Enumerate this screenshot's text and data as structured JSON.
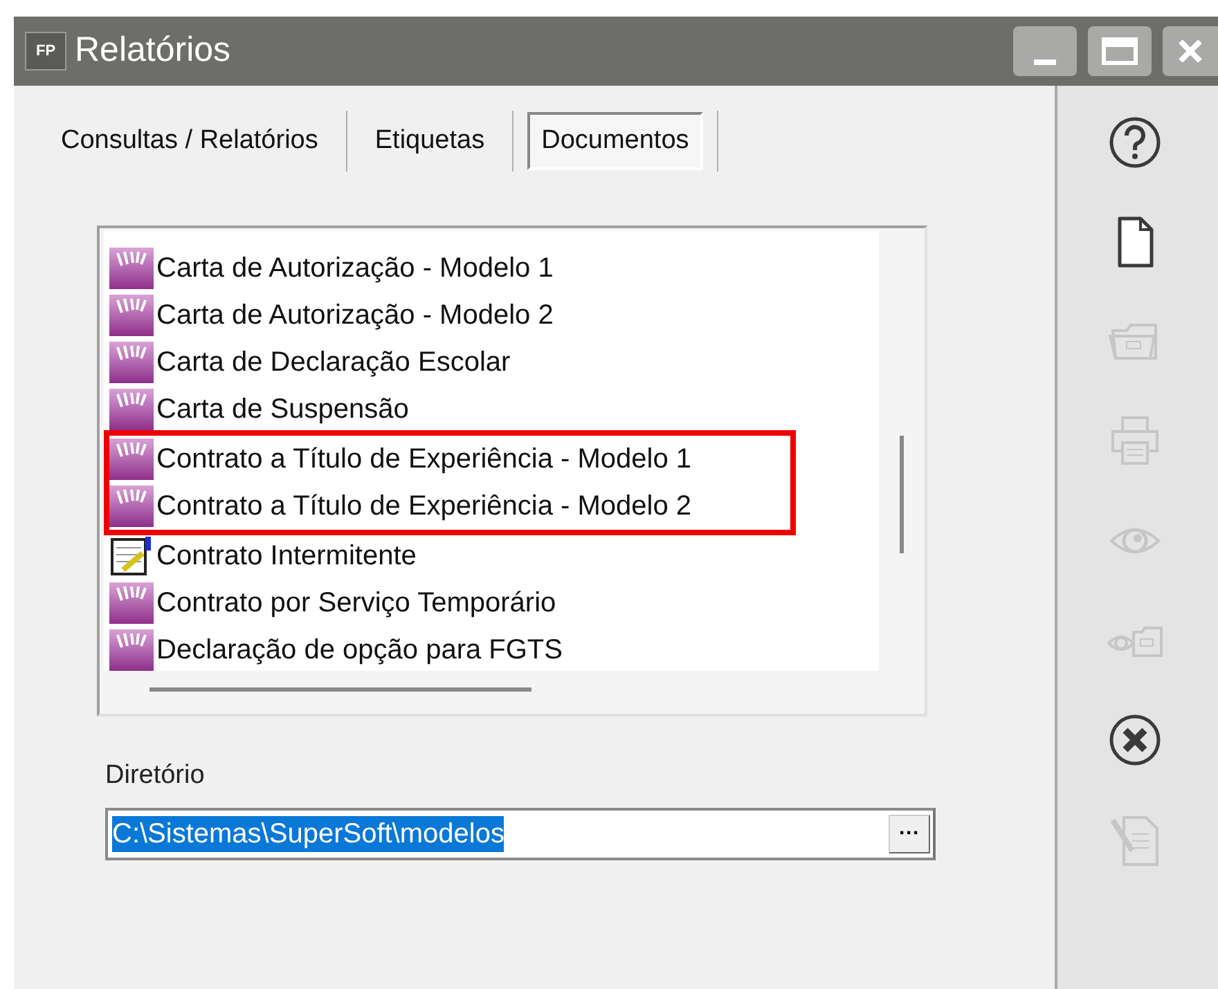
{
  "window": {
    "icon_text": "FP",
    "title": "Relatórios"
  },
  "tabs": [
    {
      "label": "Consultas / Relatórios",
      "selected": false
    },
    {
      "label": "Etiquetas",
      "selected": false
    },
    {
      "label": "Documentos",
      "selected": true
    }
  ],
  "documents": [
    {
      "kind": "model",
      "label": "Carta de Autorização - Modelo 1",
      "highlighted": false
    },
    {
      "kind": "model",
      "label": "Carta de Autorização - Modelo 2",
      "highlighted": false
    },
    {
      "kind": "model",
      "label": "Carta de Declaração Escolar",
      "highlighted": false
    },
    {
      "kind": "model",
      "label": "Carta de Suspensão",
      "highlighted": false
    },
    {
      "kind": "model",
      "label": "Contrato a Título de Experiência - Modelo 1",
      "highlighted": true
    },
    {
      "kind": "model",
      "label": "Contrato a Título de Experiência - Modelo 2",
      "highlighted": true
    },
    {
      "kind": "edit",
      "label": "Contrato Intermitente",
      "highlighted": false
    },
    {
      "kind": "model",
      "label": "Contrato por Serviço Temporário",
      "highlighted": false
    },
    {
      "kind": "model",
      "label": "Declaração de opção para FGTS",
      "highlighted": false
    }
  ],
  "directory": {
    "label": "Diretório",
    "value": "C:\\Sistemas\\SuperSoft\\modelos",
    "value_selected": true,
    "browse_button": "···"
  },
  "toolbar": [
    {
      "kind": "help",
      "disabled": false
    },
    {
      "kind": "new",
      "disabled": false
    },
    {
      "kind": "open",
      "disabled": true
    },
    {
      "kind": "print",
      "disabled": true
    },
    {
      "kind": "preview",
      "disabled": true
    },
    {
      "kind": "preview_open",
      "disabled": true
    },
    {
      "kind": "close",
      "disabled": false
    },
    {
      "kind": "edit",
      "disabled": true
    }
  ]
}
